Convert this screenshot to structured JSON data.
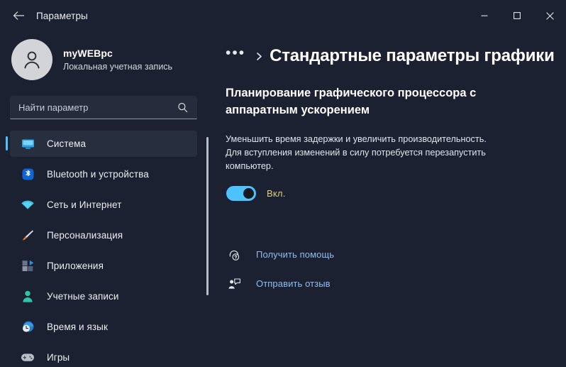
{
  "window": {
    "title": "Параметры",
    "back_label": "Назад",
    "controls": {
      "minimize": "Свернуть",
      "maximize": "Развернуть",
      "close": "Закрыть"
    }
  },
  "account": {
    "name": "myWEBpc",
    "type": "Локальная учетная запись",
    "avatar_icon": "user-avatar-icon"
  },
  "search": {
    "placeholder": "Найти параметр",
    "value": "",
    "icon": "search-icon"
  },
  "sidebar": {
    "items": [
      {
        "label": "Система",
        "icon": "system-monitor-icon",
        "selected": true
      },
      {
        "label": "Bluetooth и устройства",
        "icon": "bluetooth-icon",
        "selected": false
      },
      {
        "label": "Сеть и Интернет",
        "icon": "wifi-icon",
        "selected": false
      },
      {
        "label": "Персонализация",
        "icon": "paintbrush-icon",
        "selected": false
      },
      {
        "label": "Приложения",
        "icon": "apps-icon",
        "selected": false
      },
      {
        "label": "Учетные записи",
        "icon": "accounts-person-icon",
        "selected": false
      },
      {
        "label": "Время и язык",
        "icon": "clock-globe-icon",
        "selected": false
      },
      {
        "label": "Игры",
        "icon": "gamepad-icon",
        "selected": false
      }
    ]
  },
  "main": {
    "breadcrumb": {
      "overflow": "•••",
      "separator_icon": "chevron-right-icon",
      "title": "Стандартные параметры графики"
    },
    "section": {
      "heading": "Планирование графического процессора с аппаратным ускорением",
      "description": "Уменьшить время задержки и увеличить производительность. Для вступления изменений в силу потребуется перезапустить компьютер.",
      "toggle": {
        "state_label": "Вкл.",
        "checked": true
      }
    },
    "links": [
      {
        "label": "Получить помощь",
        "icon": "help-headset-icon"
      },
      {
        "label": "Отправить отзыв",
        "icon": "feedback-person-icon"
      }
    ]
  },
  "colors": {
    "accent": "#4cc2ff",
    "window_bg": "#1b2130",
    "selected_item_bg": "#272e3e",
    "link": "#8ebdf0",
    "toggle_label": "#d9d37a"
  }
}
